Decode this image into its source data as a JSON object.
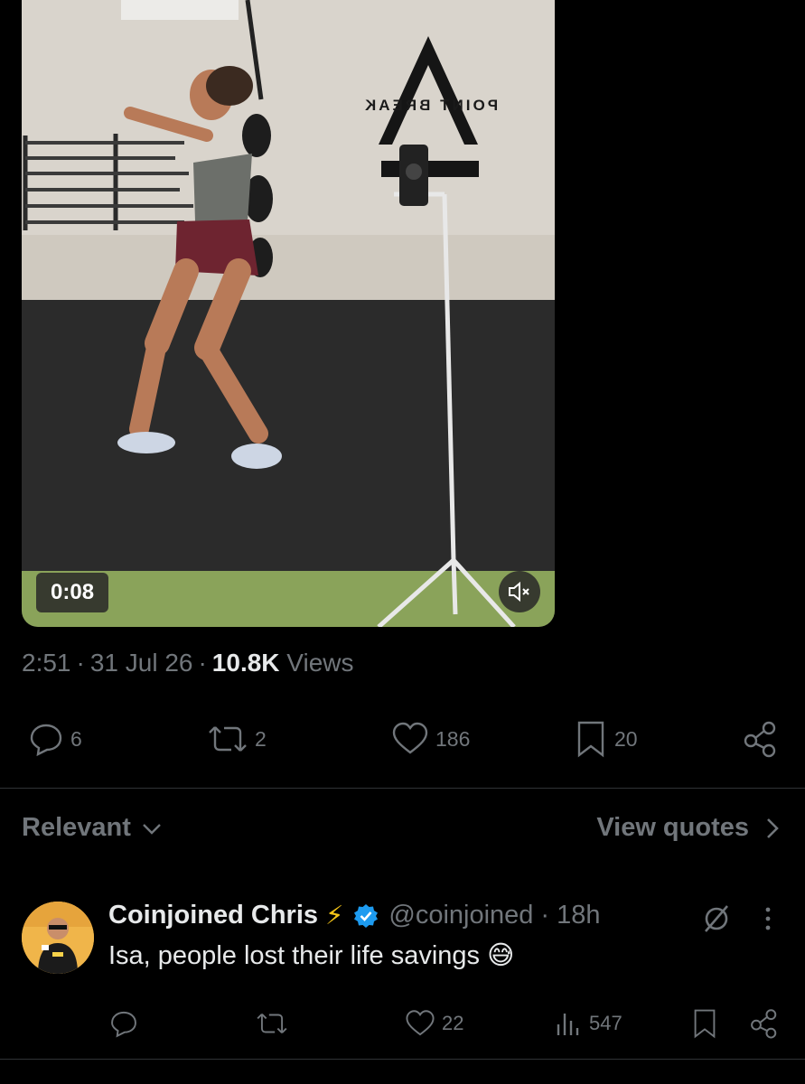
{
  "media": {
    "duration": "0:08",
    "brand_sign": "POINT BREAK",
    "icons": [
      "mute-icon"
    ]
  },
  "tweet_meta": {
    "time": "2:51",
    "date": "31 Jul 26",
    "views_count": "10.8K",
    "views_label": "Views",
    "separator": "·"
  },
  "actions": {
    "replies": "6",
    "reposts": "2",
    "likes": "186",
    "bookmarks": "20",
    "icons": [
      "reply-icon",
      "repost-icon",
      "like-icon",
      "bookmark-icon",
      "share-icon"
    ]
  },
  "sort": {
    "label": "Relevant",
    "view_quotes": "View quotes"
  },
  "reply": {
    "name": "Coinjoined Chris",
    "emoji_after_name": "⚡",
    "handle": "@coinjoined",
    "time_ago": "· 18h",
    "text": "Isa, people lost their life savings 😅",
    "actions": {
      "likes": "22",
      "views": "547"
    }
  },
  "colors": {
    "background": "#000000",
    "text_primary": "#e7e9ea",
    "text_secondary": "#71767b",
    "verified": "#1d9bf0",
    "divider": "#2f3336"
  }
}
